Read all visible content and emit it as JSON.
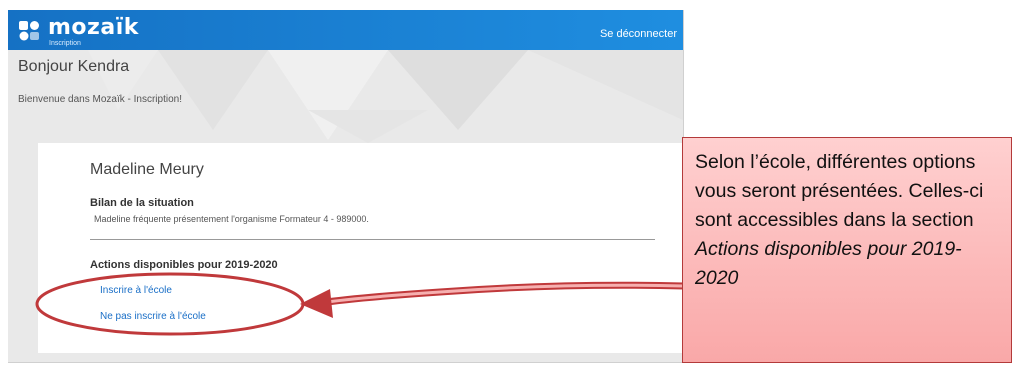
{
  "app": {
    "logo_text": "mozaïk",
    "logo_sub": "Inscription",
    "logout_label": "Se déconnecter"
  },
  "page": {
    "greeting": "Bonjour Kendra",
    "welcome": "Bienvenue dans Mozaïk - Inscription!"
  },
  "card": {
    "student_name": "Madeline Meury",
    "situation_title": "Bilan de la situation",
    "situation_text": "Madeline fréquente présentement l'organisme Formateur 4 - 989000.",
    "actions_title": "Actions disponibles pour 2019-2020",
    "actions": [
      {
        "label": "Inscrire à l'école"
      },
      {
        "label": "Ne pas inscrire à l'école"
      }
    ]
  },
  "annotation": {
    "text_plain": "Selon l’école, différentes options vous seront présentées. Celles-ci sont accessibles dans la section",
    "text_italic": "Actions disponibles pour 2019-2020",
    "colors": {
      "callout_fill": "#f9a8a8",
      "arrow": "#c0393b"
    }
  },
  "colors": {
    "topbar": "#1a7fd0",
    "link": "#1a6fc7"
  }
}
